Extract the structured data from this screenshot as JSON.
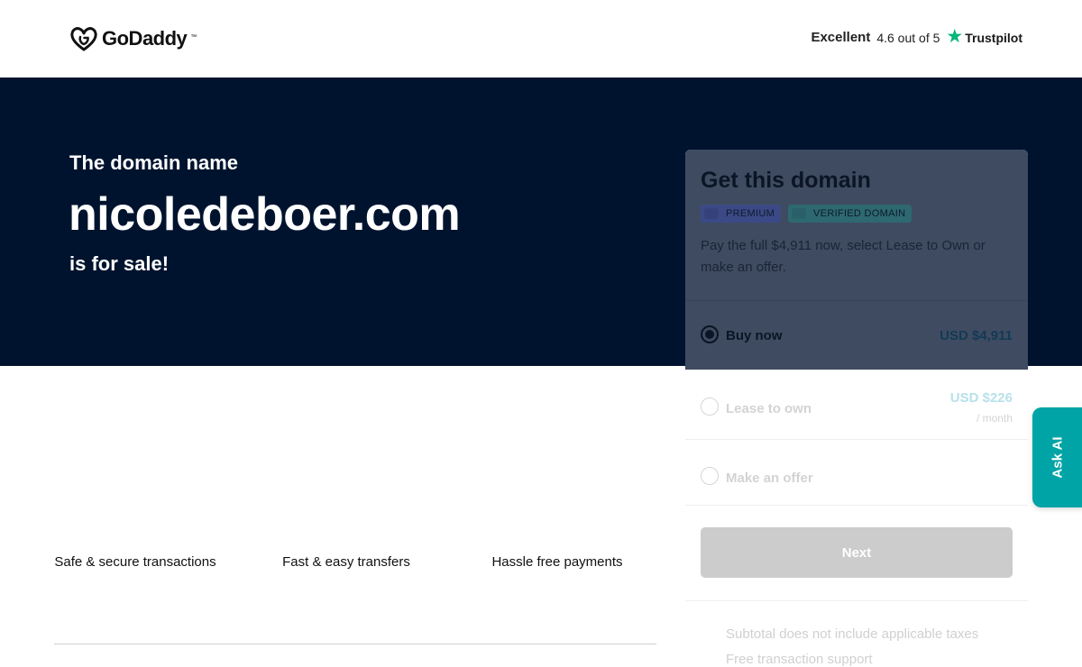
{
  "header": {
    "logo_text": "GoDaddy",
    "logo_tm": "™",
    "rating_label": "Excellent",
    "rating_score": "4.6 out of 5",
    "trustpilot_label": "Trustpilot"
  },
  "hero": {
    "pre": "The domain name",
    "domain": "nicoledeboer.com",
    "post": "is for sale!"
  },
  "features": [
    {
      "label": "Safe & secure transactions"
    },
    {
      "label": "Fast & easy transfers"
    },
    {
      "label": "Hassle free payments"
    }
  ],
  "card": {
    "title": "Get this domain",
    "badges": {
      "premium": "PREMIUM",
      "verified": "VERIFIED DOMAIN"
    },
    "description": "Pay the full $4,911 now, select Lease to Own or make an offer.",
    "options": {
      "buy": {
        "label": "Buy now",
        "price": "USD $4,911",
        "selected": true
      },
      "lease": {
        "label": "Lease to own",
        "price": "USD $226",
        "sub": "/ month",
        "selected": false
      },
      "offer": {
        "label": "Make an offer",
        "selected": false
      }
    },
    "next_label": "Next",
    "notes": [
      "Subtotal does not include applicable taxes",
      "Free transaction support"
    ]
  },
  "ask_ai": {
    "label": "Ask AI"
  },
  "colors": {
    "hero_bg": "#00132e",
    "trustpilot_green": "#00b67a",
    "ask_ai_teal": "#00a4a6",
    "card_highlight": "#3f4b61",
    "next_disabled": "#cccccc"
  },
  "icons": {
    "logo": "godaddy-heart-logo-icon",
    "trustpilot": "star-icon"
  }
}
